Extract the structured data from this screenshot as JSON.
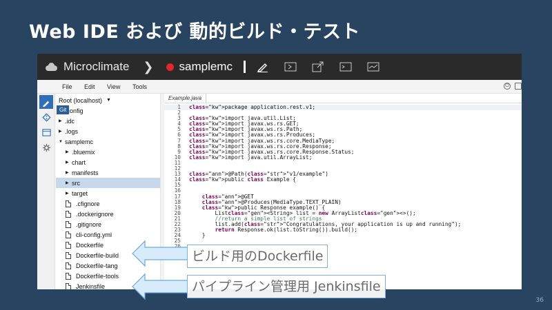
{
  "slide": {
    "title": "Web IDE および 動的ビルド・テスト",
    "page_number": "36"
  },
  "app": {
    "brand": "Microclimate",
    "project": "samplemc",
    "toolbar_icons": [
      "pencil-icon",
      "build-icon",
      "open-external-icon",
      "terminal-icon",
      "monitor-icon"
    ]
  },
  "menu": [
    "File",
    "Edit",
    "View",
    "Tools"
  ],
  "activity": {
    "tooltip": "Git",
    "icons": [
      "edit-icon",
      "git-icon",
      "console-icon",
      "gear-icon"
    ]
  },
  "tree": {
    "root": "Root (localhost)",
    "items": [
      {
        "label": ".config",
        "type": "folder",
        "level": 0
      },
      {
        "label": ".idc",
        "type": "folder",
        "level": 0
      },
      {
        "label": ".logs",
        "type": "folder",
        "level": 0
      },
      {
        "label": "samplemc",
        "type": "folder-open",
        "level": 0
      },
      {
        "label": ".bluemix",
        "type": "folder",
        "level": 1
      },
      {
        "label": "chart",
        "type": "folder",
        "level": 1
      },
      {
        "label": "manifests",
        "type": "folder",
        "level": 1
      },
      {
        "label": "src",
        "type": "folder",
        "level": 1,
        "selected": true
      },
      {
        "label": "target",
        "type": "folder",
        "level": 1
      },
      {
        "label": ".cfignore",
        "type": "file",
        "level": 1
      },
      {
        "label": ".dockerignore",
        "type": "file",
        "level": 1
      },
      {
        "label": ".gitignore",
        "type": "file",
        "level": 1
      },
      {
        "label": "cli-config.yml",
        "type": "file",
        "level": 1
      },
      {
        "label": "Dockerfile",
        "type": "file",
        "level": 1
      },
      {
        "label": "Dockerfile-build",
        "type": "file",
        "level": 1
      },
      {
        "label": "Dockerfile-tang",
        "type": "file",
        "level": 1
      },
      {
        "label": "Dockerfile-tools",
        "type": "file",
        "level": 1
      },
      {
        "label": "Jenkinsfile",
        "type": "file",
        "level": 1
      }
    ]
  },
  "editor": {
    "tab": "Example.java",
    "lines": [
      "package application.rest.v1;",
      "",
      "import java.util.List;",
      "import javax.ws.rs.GET;",
      "import javax.ws.rs.Path;",
      "import javax.ws.rs.Produces;",
      "import javax.ws.rs.core.MediaType;",
      "import javax.ws.rs.core.Response;",
      "import javax.ws.rs.core.Response.Status;",
      "import java.util.ArrayList;",
      "",
      "",
      "@Path(\"v1/example\")",
      "public class Example {",
      "",
      "",
      "    @GET",
      "    @Produces(MediaType.TEXT_PLAIN)",
      "    public Response example() {",
      "        List<String> list = new ArrayList<>();",
      "        //return a simple list of strings",
      "        list.add(\"Congratulations, your application is up and running\");",
      "        return Response.ok(list.toString()).build();",
      "    }",
      "",
      "",
      "",
      ""
    ]
  },
  "callouts": {
    "dockerfile": "ビルド用のDockerfile",
    "jenkinsfile": "パイプライン管理用 Jenkinsfile"
  },
  "colors": {
    "slide_bg": "#284461",
    "topbar": "#2a2a2a",
    "accent": "#2f6fb7",
    "status_dot": "#e0282d",
    "arrow_fill": "#d6ecfb",
    "arrow_stroke": "#6aa9d9"
  }
}
